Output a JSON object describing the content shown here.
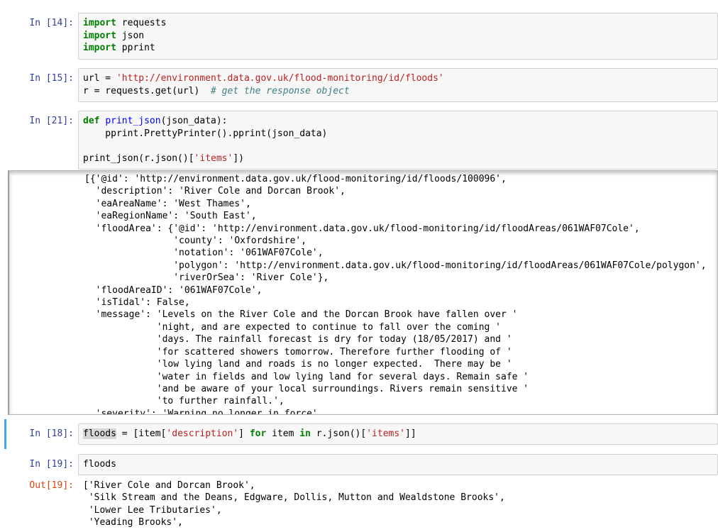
{
  "cells": [
    {
      "prompt": "In [14]:",
      "lines": [
        [
          {
            "t": "import",
            "c": "kw"
          },
          {
            "t": " requests"
          }
        ],
        [
          {
            "t": "import",
            "c": "kw"
          },
          {
            "t": " json"
          }
        ],
        [
          {
            "t": "import",
            "c": "kw"
          },
          {
            "t": " pprint"
          }
        ]
      ]
    },
    {
      "prompt": "In [15]:",
      "lines": [
        [
          {
            "t": "url = "
          },
          {
            "t": "'http://environment.data.gov.uk/flood-monitoring/id/floods'",
            "c": "str"
          }
        ],
        [
          {
            "t": "r = requests.get(url)  "
          },
          {
            "t": "# get the response object",
            "c": "cm"
          }
        ]
      ]
    },
    {
      "prompt": "In [21]:",
      "lines": [
        [
          {
            "t": "def",
            "c": "kw"
          },
          {
            "t": " "
          },
          {
            "t": "print_json",
            "c": "fn"
          },
          {
            "t": "(json_data):"
          }
        ],
        [
          {
            "t": "    pprint.PrettyPrinter().pprint(json_data)"
          }
        ],
        [
          {
            "t": ""
          }
        ],
        [
          {
            "t": "print_json(r.json()["
          },
          {
            "t": "'items'",
            "c": "str"
          },
          {
            "t": "])"
          }
        ]
      ]
    },
    {
      "prompt": "In [18]:",
      "lines": [
        [
          {
            "t": "floods",
            "c": "hl"
          },
          {
            "t": " = [item["
          },
          {
            "t": "'description'",
            "c": "str"
          },
          {
            "t": "] "
          },
          {
            "t": "for",
            "c": "kw"
          },
          {
            "t": " item "
          },
          {
            "t": "in",
            "c": "kw"
          },
          {
            "t": " r.json()["
          },
          {
            "t": "'items'",
            "c": "str"
          },
          {
            "t": "]]"
          }
        ]
      ]
    },
    {
      "prompt": "In [19]:",
      "lines": [
        [
          {
            "t": "floods"
          }
        ]
      ]
    }
  ],
  "output_21": "[{'@id': 'http://environment.data.gov.uk/flood-monitoring/id/floods/100096',\n  'description': 'River Cole and Dorcan Brook',\n  'eaAreaName': 'West Thames',\n  'eaRegionName': 'South East',\n  'floodArea': {'@id': 'http://environment.data.gov.uk/flood-monitoring/id/floodAreas/061WAF07Cole',\n                'county': 'Oxfordshire',\n                'notation': '061WAF07Cole',\n                'polygon': 'http://environment.data.gov.uk/flood-monitoring/id/floodAreas/061WAF07Cole/polygon',\n                'riverOrSea': 'River Cole'},\n  'floodAreaID': '061WAF07Cole',\n  'isTidal': False,\n  'message': 'Levels on the River Cole and the Dorcan Brook have fallen over '\n             'night, and are expected to continue to fall over the coming '\n             'days. The rainfall forecast is dry for today (18/05/2017) and '\n             'for scattered showers tomorrow. Therefore further flooding of '\n             'low lying land and roads is no longer expected.  There may be '\n             'water in fields and low lying land for several days. Remain safe '\n             'and be aware of your local surroundings. Rivers remain sensitive '\n             'to further rainfall.',\n  'severity': 'Warning no longer in force',",
  "out_19_prompt": "Out[19]:",
  "output_19": "['River Cole and Dorcan Brook',\n 'Silk Stream and the Deans, Edgware, Dollis, Mutton and Wealdstone Brooks',\n 'Lower Lee Tributaries',\n 'Yeading Brooks',"
}
